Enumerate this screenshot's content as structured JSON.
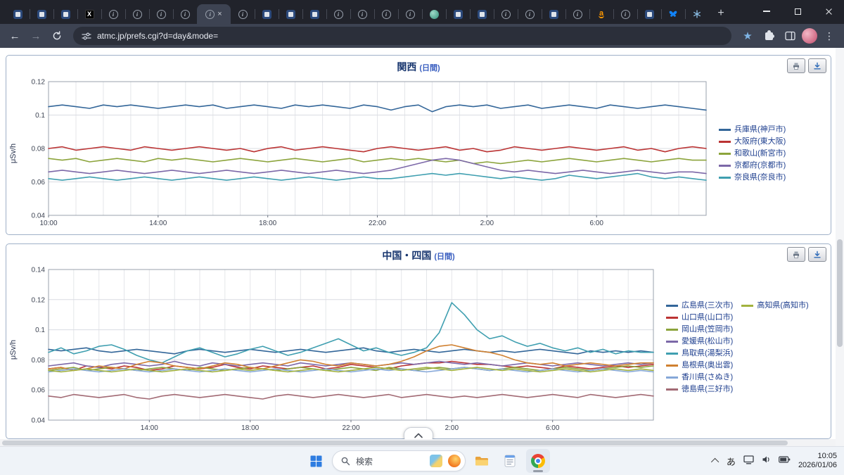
{
  "browser": {
    "tabs": {
      "active_index": 8,
      "close_icon": "×",
      "new_tab_icon": "+",
      "icons": [
        "site-square",
        "site-square",
        "site-square",
        "x-logo",
        "info-circle",
        "info-circle",
        "info-circle",
        "info-circle",
        "info-circle",
        "info-circle",
        "site-square",
        "site-square",
        "site-square",
        "info-circle",
        "info-circle",
        "info-circle",
        "info-circle",
        "globe-teal",
        "site-square",
        "site-square",
        "info-circle",
        "info-circle",
        "site-square",
        "info-circle",
        "amazon",
        "info-circle",
        "site-square",
        "bluesky",
        "snowflake"
      ]
    },
    "toolbar": {
      "back_icon": "←",
      "forward_icon": "→",
      "url": "atmc.jp/prefs.cgi?d=day&mode=",
      "star_icon": "★",
      "menu_icon": "⋮"
    }
  },
  "chart_data": [
    {
      "type": "line",
      "title": "関西",
      "title_suffix": "(日間)",
      "ylabel": "μSv/h",
      "ylim": [
        0.04,
        0.12
      ],
      "yticks": [
        0.04,
        0.06,
        0.08,
        0.1,
        0.12
      ],
      "x_span": 24,
      "grid_hour_step": 1,
      "xticks": [
        {
          "h": 0,
          "label": "10:00"
        },
        {
          "h": 4,
          "label": "14:00"
        },
        {
          "h": 8,
          "label": "18:00"
        },
        {
          "h": 12,
          "label": "22:00"
        },
        {
          "h": 16,
          "label": "2:00"
        },
        {
          "h": 20,
          "label": "6:00"
        }
      ],
      "legend_columns": 1,
      "series": [
        {
          "name": "兵庫県(神戸市)",
          "color": "#336699",
          "values": [
            0.105,
            0.106,
            0.105,
            0.104,
            0.106,
            0.105,
            0.106,
            0.105,
            0.104,
            0.105,
            0.106,
            0.105,
            0.106,
            0.104,
            0.105,
            0.106,
            0.105,
            0.104,
            0.106,
            0.105,
            0.106,
            0.105,
            0.104,
            0.106,
            0.105,
            0.103,
            0.105,
            0.106,
            0.102,
            0.105,
            0.106,
            0.105,
            0.106,
            0.104,
            0.105,
            0.106,
            0.104,
            0.105,
            0.106,
            0.105,
            0.104,
            0.106,
            0.105,
            0.104,
            0.105,
            0.106,
            0.105,
            0.104,
            0.103
          ]
        },
        {
          "name": "大阪府(東大阪)",
          "color": "#bb3333",
          "values": [
            0.08,
            0.081,
            0.079,
            0.08,
            0.081,
            0.08,
            0.079,
            0.081,
            0.08,
            0.079,
            0.08,
            0.081,
            0.08,
            0.079,
            0.08,
            0.078,
            0.08,
            0.081,
            0.079,
            0.08,
            0.081,
            0.08,
            0.079,
            0.078,
            0.08,
            0.081,
            0.08,
            0.079,
            0.08,
            0.081,
            0.079,
            0.08,
            0.078,
            0.079,
            0.081,
            0.08,
            0.079,
            0.08,
            0.081,
            0.08,
            0.079,
            0.08,
            0.081,
            0.079,
            0.08,
            0.078,
            0.08,
            0.081,
            0.08
          ]
        },
        {
          "name": "和歌山(新宮市)",
          "color": "#8ca43c",
          "values": [
            0.074,
            0.073,
            0.074,
            0.072,
            0.073,
            0.074,
            0.073,
            0.072,
            0.074,
            0.073,
            0.074,
            0.073,
            0.072,
            0.073,
            0.074,
            0.073,
            0.072,
            0.073,
            0.074,
            0.073,
            0.072,
            0.073,
            0.074,
            0.072,
            0.073,
            0.074,
            0.073,
            0.074,
            0.073,
            0.072,
            0.073,
            0.071,
            0.072,
            0.071,
            0.072,
            0.073,
            0.072,
            0.073,
            0.074,
            0.073,
            0.072,
            0.073,
            0.074,
            0.073,
            0.072,
            0.073,
            0.074,
            0.073,
            0.073
          ]
        },
        {
          "name": "京都府(京都市)",
          "color": "#7c68a8",
          "values": [
            0.066,
            0.067,
            0.066,
            0.065,
            0.066,
            0.067,
            0.066,
            0.065,
            0.066,
            0.067,
            0.066,
            0.065,
            0.066,
            0.067,
            0.066,
            0.065,
            0.066,
            0.067,
            0.066,
            0.065,
            0.066,
            0.067,
            0.066,
            0.065,
            0.066,
            0.067,
            0.069,
            0.071,
            0.073,
            0.074,
            0.073,
            0.071,
            0.069,
            0.067,
            0.066,
            0.067,
            0.066,
            0.065,
            0.066,
            0.067,
            0.066,
            0.065,
            0.066,
            0.067,
            0.066,
            0.065,
            0.066,
            0.066,
            0.065
          ]
        },
        {
          "name": "奈良県(奈良市)",
          "color": "#3f9fb0",
          "values": [
            0.062,
            0.061,
            0.062,
            0.063,
            0.062,
            0.061,
            0.062,
            0.063,
            0.062,
            0.061,
            0.062,
            0.063,
            0.062,
            0.061,
            0.062,
            0.063,
            0.062,
            0.061,
            0.062,
            0.063,
            0.062,
            0.061,
            0.062,
            0.063,
            0.062,
            0.062,
            0.063,
            0.064,
            0.065,
            0.064,
            0.065,
            0.064,
            0.063,
            0.062,
            0.063,
            0.062,
            0.061,
            0.062,
            0.064,
            0.063,
            0.062,
            0.063,
            0.064,
            0.065,
            0.063,
            0.062,
            0.063,
            0.062,
            0.061
          ]
        }
      ]
    },
    {
      "type": "line",
      "title": "中国・四国",
      "title_suffix": "(日間)",
      "ylabel": "μSv/h",
      "ylim": [
        0.04,
        0.14
      ],
      "yticks": [
        0.04,
        0.06,
        0.08,
        0.1,
        0.12,
        0.14
      ],
      "x_span": 24,
      "grid_hour_step": 1,
      "xticks": [
        {
          "h": 4,
          "label": "14:00"
        },
        {
          "h": 8,
          "label": "18:00"
        },
        {
          "h": 12,
          "label": "22:00"
        },
        {
          "h": 16,
          "label": "2:00"
        },
        {
          "h": 20,
          "label": "6:00"
        }
      ],
      "legend_columns": 2,
      "series": [
        {
          "name": "広島県(三次市)",
          "color": "#336699",
          "values": [
            0.087,
            0.086,
            0.087,
            0.088,
            0.086,
            0.085,
            0.086,
            0.087,
            0.086,
            0.085,
            0.084,
            0.086,
            0.087,
            0.086,
            0.085,
            0.086,
            0.087,
            0.086,
            0.085,
            0.086,
            0.087,
            0.086,
            0.085,
            0.086,
            0.087,
            0.088,
            0.086,
            0.085,
            0.086,
            0.087,
            0.086,
            0.085,
            0.086,
            0.087,
            0.086,
            0.085,
            0.086,
            0.085,
            0.086,
            0.087,
            0.086,
            0.085,
            0.084,
            0.086,
            0.085,
            0.086,
            0.085,
            0.086,
            0.085
          ]
        },
        {
          "name": "山口県(山口市)",
          "color": "#bb3333",
          "values": [
            0.074,
            0.075,
            0.073,
            0.076,
            0.075,
            0.074,
            0.076,
            0.075,
            0.073,
            0.074,
            0.076,
            0.075,
            0.074,
            0.075,
            0.077,
            0.075,
            0.074,
            0.076,
            0.075,
            0.074,
            0.075,
            0.076,
            0.074,
            0.075,
            0.077,
            0.076,
            0.075,
            0.074,
            0.076,
            0.077,
            0.078,
            0.078,
            0.079,
            0.078,
            0.077,
            0.077,
            0.076,
            0.075,
            0.076,
            0.075,
            0.074,
            0.076,
            0.075,
            0.074,
            0.075,
            0.076,
            0.075,
            0.076,
            0.077
          ]
        },
        {
          "name": "岡山県(笠岡市)",
          "color": "#8ca43c",
          "values": [
            0.073,
            0.074,
            0.075,
            0.073,
            0.074,
            0.075,
            0.074,
            0.073,
            0.074,
            0.075,
            0.074,
            0.073,
            0.075,
            0.074,
            0.073,
            0.074,
            0.075,
            0.074,
            0.073,
            0.074,
            0.075,
            0.074,
            0.073,
            0.074,
            0.075,
            0.074,
            0.073,
            0.075,
            0.074,
            0.073,
            0.074,
            0.075,
            0.074,
            0.075,
            0.074,
            0.073,
            0.074,
            0.075,
            0.074,
            0.073,
            0.074,
            0.075,
            0.074,
            0.073,
            0.074,
            0.075,
            0.076,
            0.075,
            0.076
          ]
        },
        {
          "name": "愛媛県(松山市)",
          "color": "#7c68a8",
          "values": [
            0.076,
            0.077,
            0.078,
            0.076,
            0.075,
            0.077,
            0.078,
            0.077,
            0.076,
            0.077,
            0.079,
            0.077,
            0.076,
            0.078,
            0.077,
            0.076,
            0.077,
            0.078,
            0.077,
            0.076,
            0.078,
            0.077,
            0.076,
            0.077,
            0.078,
            0.077,
            0.076,
            0.077,
            0.078,
            0.077,
            0.078,
            0.079,
            0.078,
            0.077,
            0.078,
            0.077,
            0.076,
            0.077,
            0.078,
            0.077,
            0.076,
            0.077,
            0.078,
            0.077,
            0.076,
            0.077,
            0.078,
            0.077,
            0.078
          ]
        },
        {
          "name": "鳥取県(湯梨浜)",
          "color": "#3f9fb0",
          "values": [
            0.085,
            0.088,
            0.084,
            0.086,
            0.089,
            0.09,
            0.087,
            0.083,
            0.08,
            0.078,
            0.082,
            0.086,
            0.088,
            0.085,
            0.082,
            0.084,
            0.087,
            0.089,
            0.086,
            0.083,
            0.085,
            0.088,
            0.091,
            0.094,
            0.09,
            0.086,
            0.088,
            0.085,
            0.083,
            0.085,
            0.088,
            0.098,
            0.118,
            0.11,
            0.1,
            0.094,
            0.096,
            0.092,
            0.089,
            0.091,
            0.088,
            0.086,
            0.088,
            0.085,
            0.087,
            0.084,
            0.086,
            0.085,
            0.085
          ]
        },
        {
          "name": "島根県(奥出雲)",
          "color": "#d08030",
          "values": [
            0.074,
            0.075,
            0.073,
            0.074,
            0.076,
            0.075,
            0.074,
            0.077,
            0.079,
            0.078,
            0.076,
            0.075,
            0.074,
            0.076,
            0.078,
            0.077,
            0.075,
            0.074,
            0.076,
            0.078,
            0.08,
            0.079,
            0.077,
            0.076,
            0.078,
            0.077,
            0.076,
            0.077,
            0.079,
            0.082,
            0.086,
            0.089,
            0.09,
            0.088,
            0.086,
            0.085,
            0.083,
            0.08,
            0.078,
            0.077,
            0.078,
            0.076,
            0.077,
            0.078,
            0.077,
            0.076,
            0.077,
            0.078,
            0.078
          ]
        },
        {
          "name": "香川県(さぬき)",
          "color": "#86a8d8",
          "values": [
            0.072,
            0.073,
            0.074,
            0.073,
            0.072,
            0.073,
            0.074,
            0.073,
            0.072,
            0.073,
            0.074,
            0.073,
            0.072,
            0.073,
            0.074,
            0.073,
            0.072,
            0.073,
            0.074,
            0.073,
            0.072,
            0.073,
            0.074,
            0.073,
            0.072,
            0.073,
            0.074,
            0.073,
            0.074,
            0.073,
            0.072,
            0.073,
            0.074,
            0.075,
            0.074,
            0.073,
            0.074,
            0.073,
            0.072,
            0.073,
            0.074,
            0.073,
            0.072,
            0.073,
            0.074,
            0.073,
            0.072,
            0.073,
            0.072
          ]
        },
        {
          "name": "徳島県(三好市)",
          "color": "#a26a74",
          "values": [
            0.056,
            0.055,
            0.057,
            0.056,
            0.055,
            0.056,
            0.057,
            0.055,
            0.054,
            0.056,
            0.057,
            0.056,
            0.055,
            0.056,
            0.057,
            0.056,
            0.055,
            0.054,
            0.056,
            0.057,
            0.056,
            0.055,
            0.056,
            0.057,
            0.056,
            0.055,
            0.056,
            0.057,
            0.055,
            0.056,
            0.057,
            0.056,
            0.055,
            0.056,
            0.055,
            0.056,
            0.057,
            0.056,
            0.055,
            0.056,
            0.057,
            0.056,
            0.055,
            0.057,
            0.056,
            0.055,
            0.056,
            0.057,
            0.056
          ]
        },
        {
          "name": "高知県(高知市)",
          "color": "#a2b23e",
          "values": [
            0.073,
            0.072,
            0.073,
            0.074,
            0.073,
            0.072,
            0.073,
            0.074,
            0.073,
            0.072,
            0.073,
            0.074,
            0.073,
            0.072,
            0.073,
            0.074,
            0.073,
            0.074,
            0.073,
            0.072,
            0.073,
            0.074,
            0.073,
            0.072,
            0.073,
            0.074,
            0.075,
            0.074,
            0.073,
            0.074,
            0.075,
            0.074,
            0.073,
            0.074,
            0.075,
            0.074,
            0.073,
            0.074,
            0.073,
            0.072,
            0.073,
            0.074,
            0.073,
            0.072,
            0.073,
            0.074,
            0.073,
            0.074,
            0.073
          ]
        }
      ]
    }
  ],
  "taskbar": {
    "search_label": "検索",
    "ime_label": "あ",
    "clock": {
      "time": "10:05",
      "date": "2026/01/06"
    }
  }
}
